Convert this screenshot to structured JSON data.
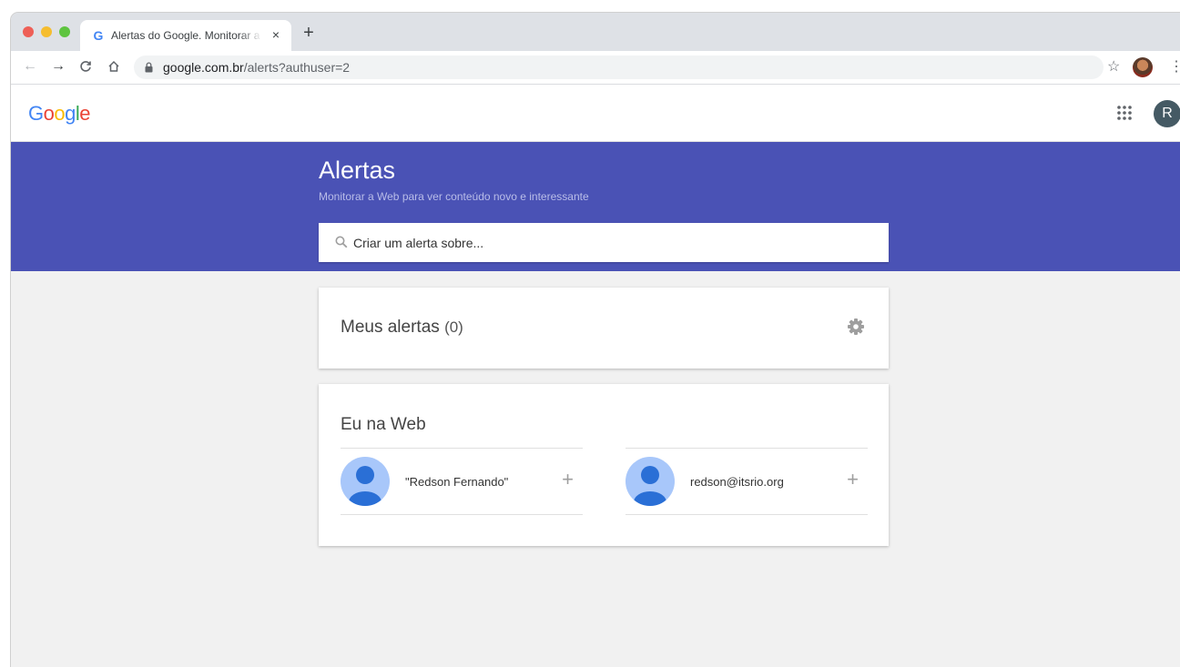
{
  "browser": {
    "tab": {
      "title": "Alertas do Google. Monitorar a",
      "favicon": "google-g-icon",
      "close_label": "×"
    },
    "new_tab_label": "+",
    "nav": {
      "back": "←",
      "forward": "→",
      "reload": "C",
      "home": "⌂"
    },
    "url": {
      "host": "google.com.br",
      "path": "/alerts?authuser=2"
    },
    "star_label": "☆",
    "menu_label": "⋮"
  },
  "gbar": {
    "logo": [
      "G",
      "o",
      "o",
      "g",
      "l",
      "e"
    ],
    "logo_colors": [
      "#4285f4",
      "#ea4335",
      "#fbbc05",
      "#4285f4",
      "#34a853",
      "#ea4335"
    ],
    "account_initial": "R"
  },
  "hero": {
    "title": "Alertas",
    "subtitle": "Monitorar a Web para ver conteúdo novo e interessante",
    "search_placeholder": "Criar um alerta sobre...",
    "color": "#4a52b5"
  },
  "my_alerts": {
    "title": "Meus alertas",
    "count": "(0)"
  },
  "me_on_web": {
    "title": "Eu na Web",
    "entries": [
      {
        "label": "\"Redson Fernando\"",
        "add": "+"
      },
      {
        "label": "redson@itsrio.org",
        "add": "+"
      }
    ]
  }
}
